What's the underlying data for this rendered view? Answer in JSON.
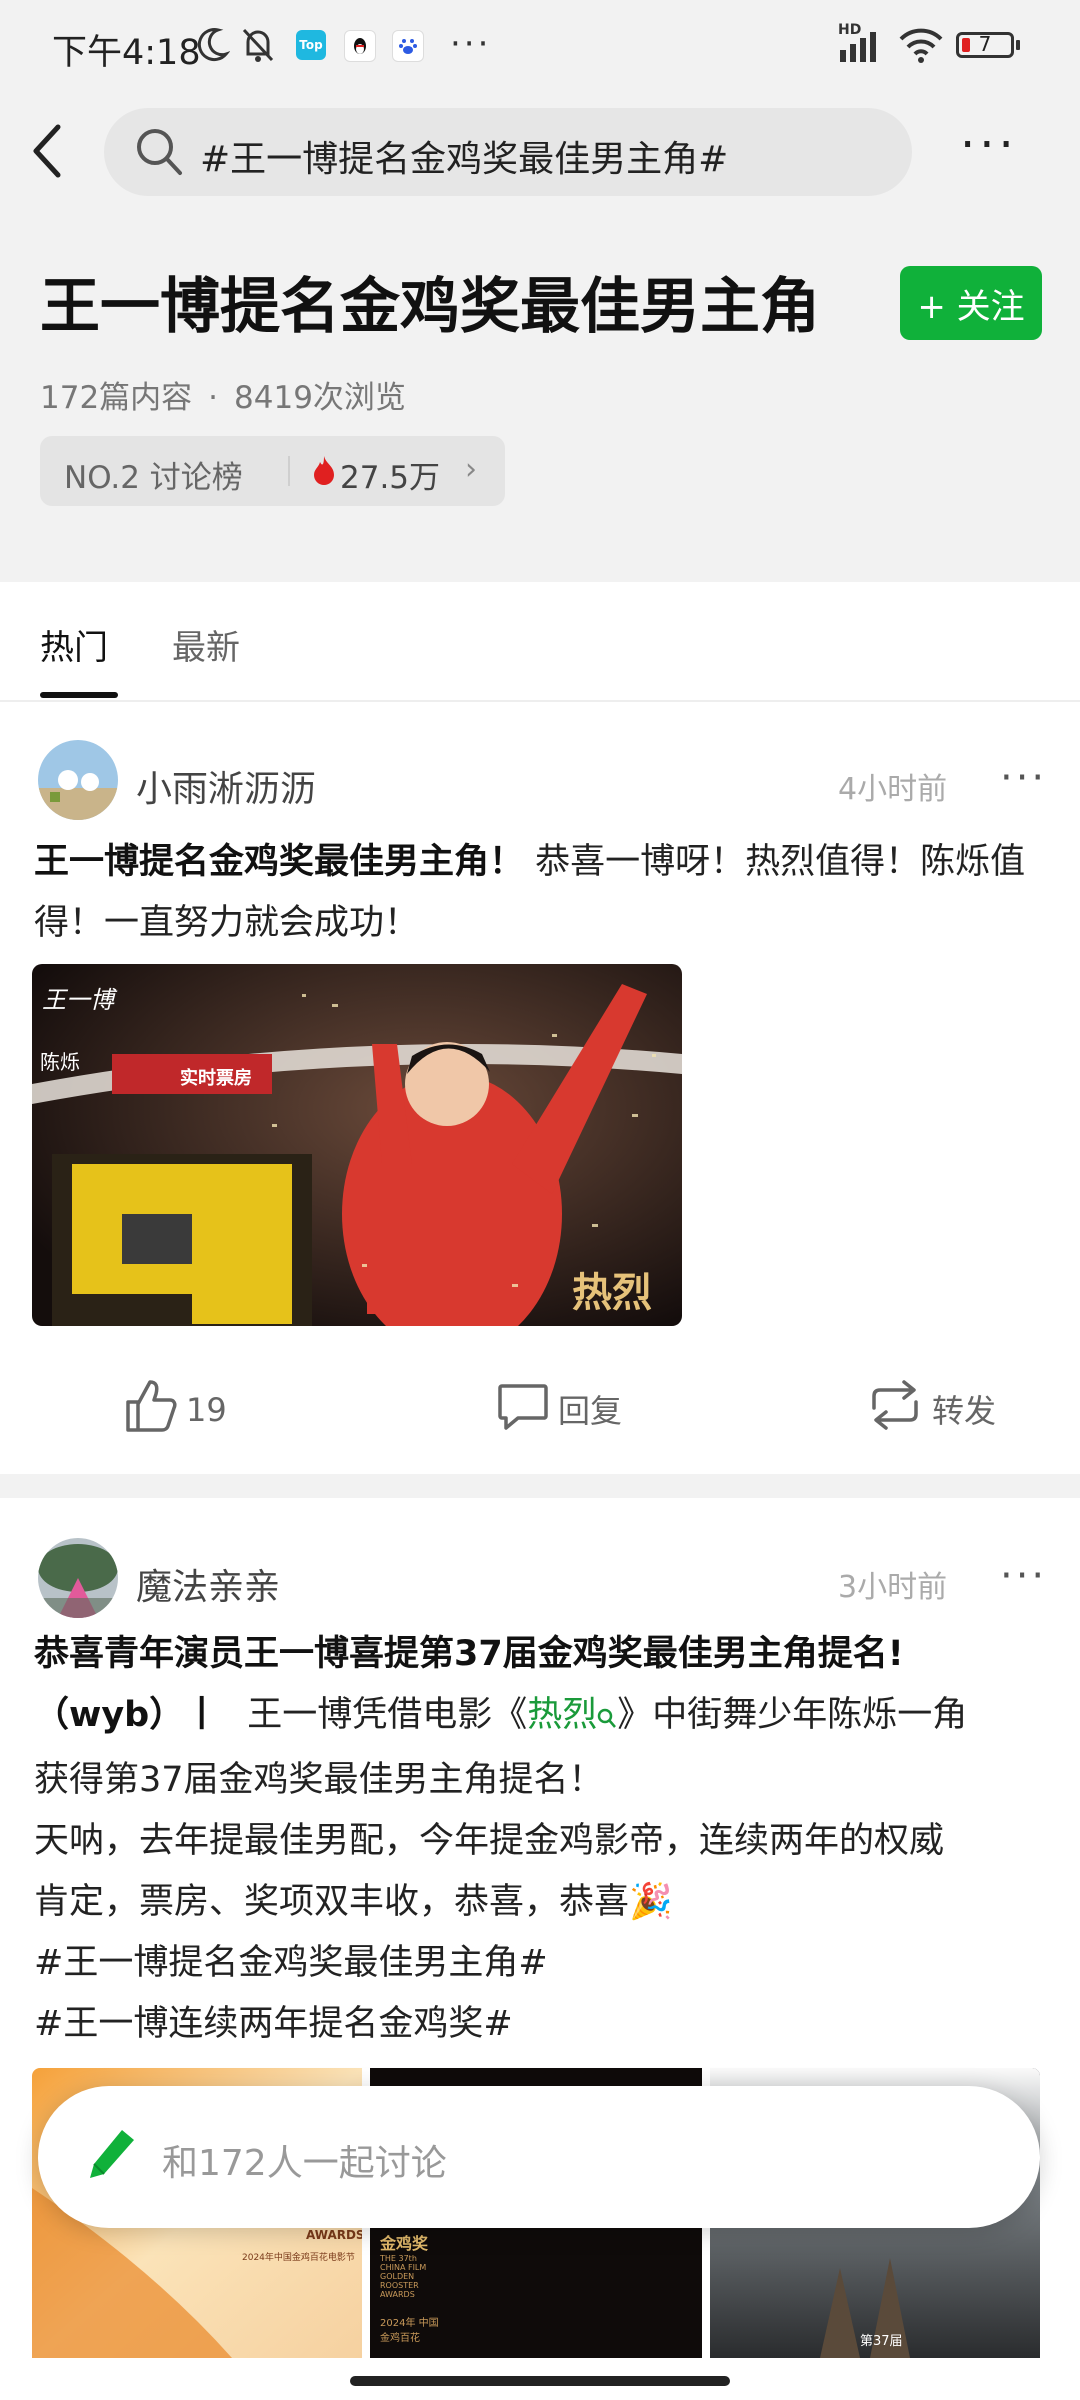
{
  "status_bar": {
    "time": "下午4:18",
    "app_badge_top": "Top",
    "network_label": "HD",
    "battery_level": "7",
    "more_dots": "···"
  },
  "header": {
    "search_text": "#王一博提名金鸡奖最佳男主角#",
    "more_dots": "···"
  },
  "topic": {
    "title": "王一博提名金鸡奖最佳男主角",
    "follow_label": "+ 关注",
    "content_count": "172篇内容",
    "separator": "·",
    "views": "8419次浏览",
    "rank_label": "NO.2 讨论榜",
    "hot_value": "27.5万",
    "chevron": "›"
  },
  "tabs": [
    {
      "label": "热门",
      "active": true
    },
    {
      "label": "最新",
      "active": false
    }
  ],
  "posts": [
    {
      "username": "小雨淅沥沥",
      "time": "4小时前",
      "more": "···",
      "text_bold": "王一博提名金鸡奖最佳男主角！",
      "text_rest": "恭喜一博呀！热烈值得！陈烁值得！一直努力就会成功！",
      "image_overlay": {
        "signature": "王一博",
        "name_tag": "陈烁",
        "banner": "实时票房",
        "logo": "热烈"
      },
      "like_count": "19",
      "reply_label": "回复",
      "repost_label": "转发"
    },
    {
      "username": "魔法亲亲",
      "time": "3小时前",
      "more": "···",
      "line1_bold": "恭喜青年演员王一博喜提第37届金鸡奖最佳男主角提名!",
      "line2_bold": "（wyb）丨",
      "line2_a": "王一博凭借电影《",
      "line2_link": "热烈",
      "line2_b": "》中街舞少年陈烁一角",
      "line3": "获得第37届金鸡奖最佳男主角提名！",
      "line4": "天呐，去年提最佳男配，今年提金鸡影帝，连续两年的权威",
      "line5": "肯定，票房、奖项双丰收，恭喜，恭喜🎉",
      "tag1": "#王一博提名金鸡奖最佳男主角#",
      "tag2": "#王一博连续两年提名金鸡奖#",
      "images": [
        {
          "caption": "AWARDS",
          "sub": "2024年中国金鸡百花电影节"
        },
        {
          "caption": "金鸡奖",
          "sub": "THE 37th CHINA FILM GOLDEN ROOSTER AWARDS",
          "sub2": "2024年 中国金鸡百花"
        },
        {
          "caption": "第37届"
        }
      ]
    }
  ],
  "bottom_input": {
    "placeholder": "和172人一起讨论"
  },
  "colors": {
    "accent_green": "#10b13a",
    "link_green": "#1a9a3a",
    "hot_red": "#e02020"
  }
}
